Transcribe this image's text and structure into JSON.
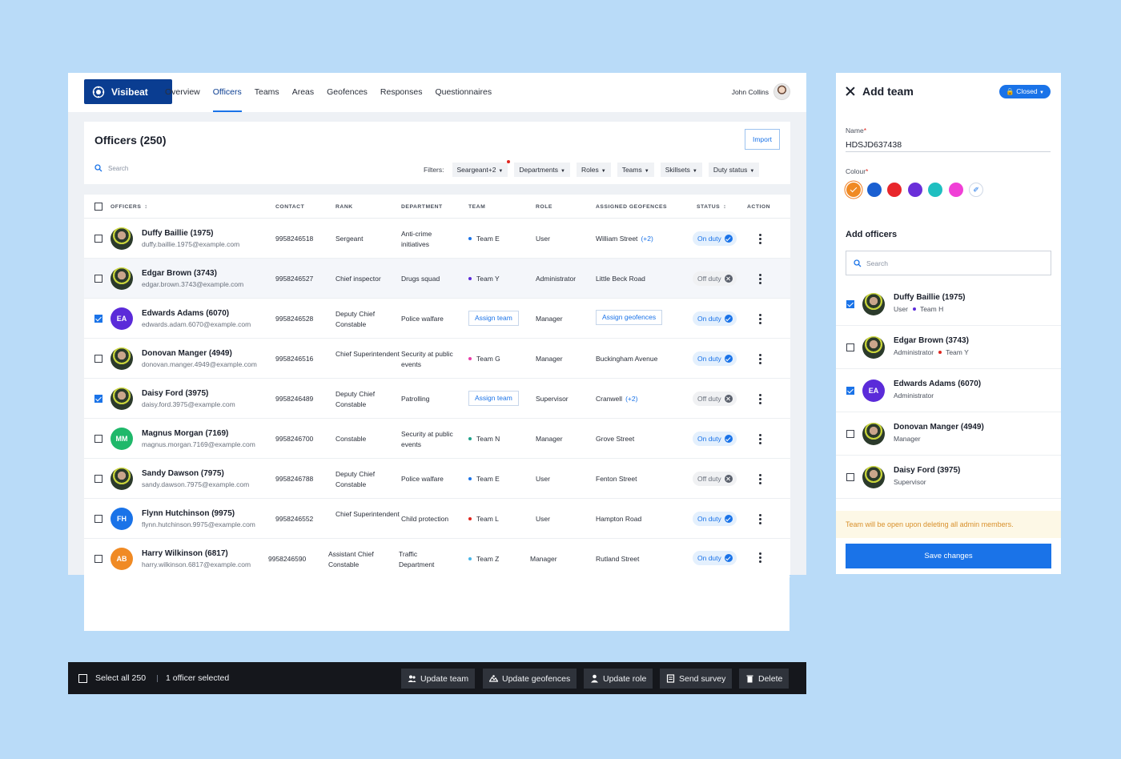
{
  "brand": {
    "name": "Visibeat"
  },
  "nav": [
    {
      "label": "Overview"
    },
    {
      "label": "Officers",
      "active": true
    },
    {
      "label": "Teams"
    },
    {
      "label": "Areas"
    },
    {
      "label": "Geofences"
    },
    {
      "label": "Responses"
    },
    {
      "label": "Questionnaires"
    }
  ],
  "user": {
    "name": "John Collins"
  },
  "officers": {
    "title": "Officers (250)",
    "import_label": "Import",
    "search_placeholder": "Search",
    "filters_label": "Filters:",
    "filters": [
      {
        "label": "Seargeant+2",
        "active": true
      },
      {
        "label": "Departments"
      },
      {
        "label": "Roles"
      },
      {
        "label": "Teams"
      },
      {
        "label": "Skillsets"
      },
      {
        "label": "Duty status"
      }
    ],
    "columns": {
      "officers": "OFFICERS",
      "contact": "CONTACT",
      "rank": "RANK",
      "department": "DEPARTMENT",
      "team": "TEAM",
      "role": "ROLE",
      "geofences": "ASSIGNED GEOFENCES",
      "status": "STATUS",
      "action": "ACTION"
    },
    "rows": [
      {
        "name": "Duffy Baillie (1975)",
        "email": "duffy.baillie.1975@example.com",
        "avatar": "photo",
        "checked": false,
        "contact": "9958246518",
        "rank": "Sergeant",
        "department": "Anti-crime initiatives",
        "team": "Team E",
        "team_color": "#1a73e8",
        "role": "User",
        "geofence": "William Street",
        "geofence_more": "(+2)",
        "status": "On duty",
        "on": true
      },
      {
        "name": "Edgar Brown (3743)",
        "email": "edgar.brown.3743@example.com",
        "avatar": "photo",
        "checked": false,
        "highlight": true,
        "contact": "9958246527",
        "rank": "Chief inspector",
        "department": "Drugs squad",
        "team": "Team Y",
        "team_color": "#5b2bd9",
        "role": "Administrator",
        "geofence": "Little Beck Road",
        "geofence_more": "",
        "status": "Off duty",
        "on": false
      },
      {
        "name": "Edwards Adams (6070)",
        "email": "edwards.adam.6070@example.com",
        "avatar": "EA",
        "avatar_color": "#5b2bd9",
        "checked": true,
        "contact": "9958246528",
        "rank": "Deputy Chief Constable",
        "department": "Police walfare",
        "team": "",
        "team_action": "Assign team",
        "role": "Manager",
        "geofence": "",
        "geofence_action": "Assign geofences",
        "status": "On duty",
        "on": true
      },
      {
        "name": "Donovan Manger (4949)",
        "email": "donovan.manger.4949@example.com",
        "avatar": "photo",
        "checked": false,
        "contact": "9958246516",
        "rank": "Chief Superintendent",
        "department": "Security at public events",
        "team": "Team G",
        "team_color": "#e83ea8",
        "role": "Manager",
        "geofence": "Buckingham Avenue",
        "geofence_more": "",
        "status": "On duty",
        "on": true
      },
      {
        "name": "Daisy Ford (3975)",
        "email": "daisy.ford.3975@example.com",
        "avatar": "photo",
        "checked": true,
        "contact": "9958246489",
        "rank": "Deputy Chief Constable",
        "department": "Patrolling",
        "team": "",
        "team_action": "Assign team",
        "role": "Supervisor",
        "geofence": "Cranwell",
        "geofence_more": "(+2)",
        "status": "Off duty",
        "on": false
      },
      {
        "name": "Magnus Morgan (7169)",
        "email": "magnus.morgan.7169@example.com",
        "avatar": "MM",
        "avatar_color": "#1fb86a",
        "checked": false,
        "contact": "9958246700",
        "rank": "Constable",
        "department": "Security at public events",
        "team": "Team N",
        "team_color": "#1fa28a",
        "role": "Manager",
        "geofence": "Grove Street",
        "geofence_more": "",
        "status": "On duty",
        "on": true
      },
      {
        "name": "Sandy Dawson (7975)",
        "email": "sandy.dawson.7975@example.com",
        "avatar": "photo",
        "checked": false,
        "contact": "9958246788",
        "rank": "Deputy Chief Constable",
        "department": "Police walfare",
        "team": "Team E",
        "team_color": "#1a73e8",
        "role": "User",
        "geofence": "Fenton Street",
        "geofence_more": "",
        "status": "Off duty",
        "on": false
      },
      {
        "name": "Flynn Hutchinson (9975)",
        "email": "flynn.hutchinson.9975@example.com",
        "avatar": "FH",
        "avatar_color": "#1a73e8",
        "checked": false,
        "contact": "9958246552",
        "rank": "Chief Superintendent",
        "department": "Child protection",
        "team": "Team L",
        "team_color": "#e0261f",
        "role": "User",
        "geofence": "Hampton Road",
        "geofence_more": "",
        "status": "On duty",
        "on": true
      },
      {
        "name": "Harry Wilkinson (6817)",
        "email": "harry.wilkinson.6817@example.com",
        "avatar": "AB",
        "avatar_color": "#f08a24",
        "checked": false,
        "contact": "9958246590",
        "rank": "Assistant Chief Constable",
        "department": "Traffic Department",
        "team": "Team Z",
        "team_color": "#49b6e8",
        "role": "Manager",
        "geofence": "Rutland Street",
        "geofence_more": "",
        "status": "On duty",
        "on": true
      }
    ]
  },
  "panel": {
    "title": "Add team",
    "state_label": "Closed",
    "name_label": "Name",
    "name_value": "HDSJD637438",
    "colour_label": "Colour",
    "colours": [
      "#f08a24",
      "#1a5fd1",
      "#e8262b",
      "#6a2fd9",
      "#1fbfc0",
      "#f03fd6"
    ],
    "selected_colour": 0,
    "add_officers_label": "Add officers",
    "search_placeholder": "Search",
    "members": [
      {
        "name": "Duffy Baillie (1975)",
        "role": "User",
        "team": "Team H",
        "team_color": "#5b2bd9",
        "checked": true,
        "avatar": "photo"
      },
      {
        "name": "Edgar Brown (3743)",
        "role": "Administrator",
        "team": "Team Y",
        "team_color": "#e0261f",
        "checked": false,
        "avatar": "photo"
      },
      {
        "name": "Edwards Adams (6070)",
        "role": "Administrator",
        "team": "",
        "checked": true,
        "avatar": "EA",
        "avatar_color": "#5b2bd9"
      },
      {
        "name": "Donovan Manger (4949)",
        "role": "Manager",
        "team": "",
        "checked": false,
        "avatar": "photo"
      },
      {
        "name": "Daisy Ford (3975)",
        "role": "Supervisor",
        "team": "",
        "checked": false,
        "avatar": "photo"
      }
    ],
    "notice": "Team will be open upon deleting all admin members.",
    "save_label": "Save changes"
  },
  "actionbar": {
    "select_all": "Select all 250",
    "selected": "1 officer selected",
    "buttons": [
      {
        "label": "Update team",
        "icon": "team-icon"
      },
      {
        "label": "Update geofences",
        "icon": "geofence-icon"
      },
      {
        "label": "Update role",
        "icon": "person-icon"
      },
      {
        "label": "Send survey",
        "icon": "survey-icon"
      },
      {
        "label": "Delete",
        "icon": "trash-icon"
      }
    ]
  }
}
